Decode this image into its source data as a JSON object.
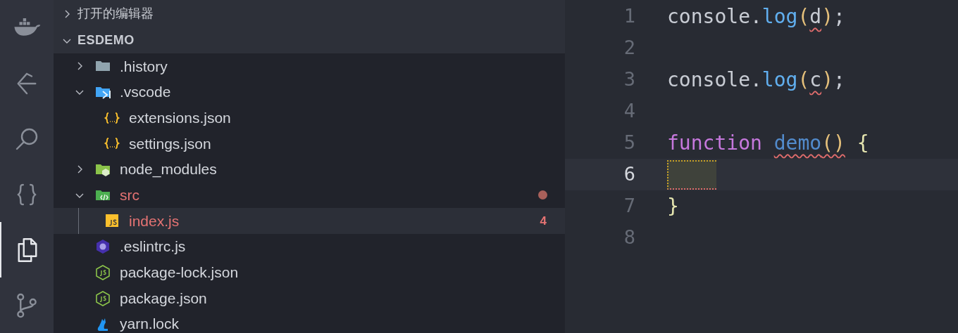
{
  "activity_bar": [
    {
      "kind": "docker",
      "selected": false
    },
    {
      "kind": "eslint-ext",
      "selected": false
    },
    {
      "kind": "search",
      "selected": false
    },
    {
      "kind": "braces",
      "selected": false
    },
    {
      "kind": "explorer",
      "selected": true
    },
    {
      "kind": "source-control",
      "selected": false
    }
  ],
  "open_editors": {
    "label": "打开的编辑器",
    "expanded": false
  },
  "project": {
    "label": "ESDEMO",
    "expanded": true,
    "items": [
      {
        "name": ".history",
        "kind": "folder",
        "expanded": false,
        "selected": false,
        "error": false,
        "modified": false
      },
      {
        "name": ".vscode",
        "kind": "vscode-folder",
        "expanded": true,
        "selected": false,
        "error": false,
        "modified": false,
        "children": [
          {
            "name": "extensions.json",
            "kind": "json",
            "selected": false,
            "error": false,
            "modified": false
          },
          {
            "name": "settings.json",
            "kind": "json",
            "selected": false,
            "error": false,
            "modified": false
          }
        ]
      },
      {
        "name": "node_modules",
        "kind": "node-folder",
        "expanded": false,
        "selected": false,
        "error": false,
        "modified": false
      },
      {
        "name": "src",
        "kind": "src-folder",
        "expanded": true,
        "selected": false,
        "error": true,
        "modified": true,
        "children": [
          {
            "name": "index.js",
            "kind": "js",
            "selected": true,
            "error": true,
            "modified": false,
            "badge": "4"
          }
        ]
      },
      {
        "name": ".eslintrc.js",
        "kind": "eslint",
        "selected": false,
        "error": false,
        "modified": false
      },
      {
        "name": "package-lock.json",
        "kind": "npm",
        "selected": false,
        "error": false,
        "modified": false
      },
      {
        "name": "package.json",
        "kind": "npm",
        "selected": false,
        "error": false,
        "modified": false
      },
      {
        "name": "yarn.lock",
        "kind": "yarn",
        "selected": false,
        "error": false,
        "modified": false
      }
    ]
  },
  "editor": {
    "lines": [
      {
        "number": "1",
        "current": false,
        "tokens": [
          {
            "text": "console.",
            "kind": "plain"
          },
          {
            "text": "log",
            "kind": "method"
          },
          {
            "text": "(",
            "kind": "paren"
          },
          {
            "text": "d",
            "kind": "plain",
            "squiggle": true
          },
          {
            "text": ")",
            "kind": "paren"
          },
          {
            "text": ";",
            "kind": "plain"
          }
        ]
      },
      {
        "number": "2",
        "current": false
      },
      {
        "number": "3",
        "current": false,
        "tokens": [
          {
            "text": "console.",
            "kind": "plain"
          },
          {
            "text": "log",
            "kind": "method"
          },
          {
            "text": "(",
            "kind": "paren"
          },
          {
            "text": "c",
            "kind": "plain",
            "squiggle": true
          },
          {
            "text": ")",
            "kind": "paren"
          },
          {
            "text": ";",
            "kind": "plain"
          }
        ]
      },
      {
        "number": "4",
        "current": false
      },
      {
        "number": "5",
        "current": false,
        "tokens": [
          {
            "text": "function ",
            "kind": "keyword"
          },
          {
            "text": "demo",
            "kind": "func",
            "squiggle": true
          },
          {
            "text": "()",
            "kind": "paren",
            "squiggle": true
          },
          {
            "text": " {",
            "kind": "brace"
          }
        ]
      },
      {
        "number": "6",
        "current": true
      },
      {
        "number": "7",
        "current": false,
        "tokens": [
          {
            "text": "}",
            "kind": "brace"
          }
        ]
      },
      {
        "number": "8",
        "current": false
      }
    ]
  }
}
